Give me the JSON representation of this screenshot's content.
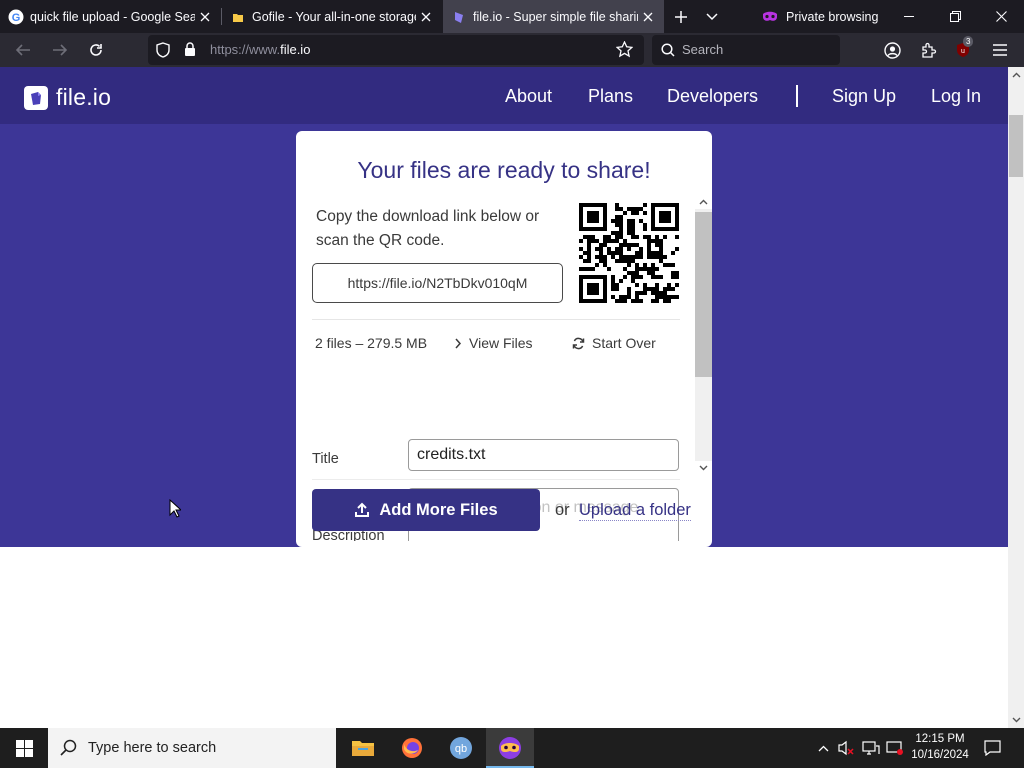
{
  "browser": {
    "tabs": [
      {
        "title": "quick file upload - Google Search"
      },
      {
        "title": "Gofile - Your all-in-one storage solution"
      },
      {
        "title": "file.io - Super simple file sharing"
      }
    ],
    "private_label": "Private browsing",
    "url": {
      "prefix": "https://www.",
      "domain": "file.io"
    },
    "search_placeholder": "Search",
    "extension_badge": "3"
  },
  "site": {
    "logo_text": "file.io",
    "nav": {
      "about": "About",
      "plans": "Plans",
      "developers": "Developers",
      "signup": "Sign Up",
      "login": "Log In"
    }
  },
  "card": {
    "title": "Your files are ready to share!",
    "instructions": "Copy the download link below or scan the QR code.",
    "share_link": "https://file.io/N2TbDkv010qM",
    "file_summary": "2 files – 279.5 MB",
    "view_files": "View Files",
    "start_over": "Start Over",
    "title_label": "Title",
    "title_value": "credits.txt",
    "description_label": "Description",
    "description_placeholder": "Enter a description or message",
    "add_more_files": "Add More Files",
    "or_text": "or",
    "upload_folder": "Upload a folder"
  },
  "taskbar": {
    "search_placeholder": "Type here to search",
    "time": "12:15 PM",
    "date": "10/16/2024"
  },
  "colors": {
    "hero": "#3d3697",
    "navbar": "#322b80",
    "brand": "#363285",
    "browser_dark": "#1c1b22"
  }
}
